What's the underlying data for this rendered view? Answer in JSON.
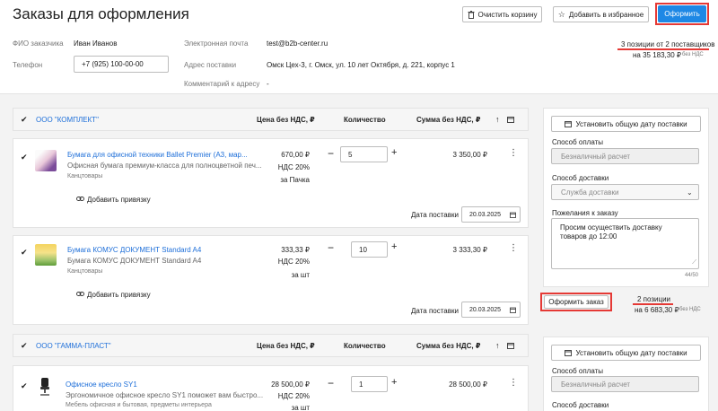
{
  "page": {
    "title": "Заказы для оформления",
    "buttons": {
      "clear_cart": "Очистить корзину",
      "add_favorites": "Добавить в избранное",
      "checkout": "Оформить"
    }
  },
  "customer": {
    "name_label": "ФИО заказчика",
    "name_value": "Иван Иванов",
    "phone_label": "Телефон",
    "phone_value": "+7 (925) 100-00-00",
    "email_label": "Электронная почта",
    "email_value": "test@b2b-center.ru",
    "address_label": "Адрес поставки",
    "address_value": "Омск Цех-3, г. Омск, ул. 10 лет Октября, д. 221, корпус 1",
    "comment_label": "Комментарий к адресу",
    "comment_value": "-"
  },
  "summary": {
    "positions": "3 позиции от 2 поставщиков",
    "total": "на 35 183,30 ₽",
    "vat": "без НДС"
  },
  "columns": {
    "price": "Цена без НДС, ₽",
    "qty": "Количество",
    "sum": "Сумма без НДС, ₽"
  },
  "suppliers": [
    {
      "name": "ООО \"КОМПЛЕКТ\"",
      "items": [
        {
          "title": "Бумага для офисной техники Ballet Premier (А3, мар...",
          "desc": "Офисная бумага премиум-класса для полноцветной печ...",
          "category": "Канцтовары",
          "price": "670,00 ₽",
          "vat": "НДС 20%",
          "unit": "за Пачка",
          "qty": "5",
          "sum": "3 350,00 ₽",
          "bind": "Добавить привязку",
          "date_label": "Дата поставки",
          "date": "20.03.2025"
        },
        {
          "title": "Бумага КОМУС ДОКУМЕНТ Standard A4",
          "desc": "Бумага КОМУС ДОКУМЕНТ Standard A4",
          "category": "Канцтовары",
          "price": "333,33 ₽",
          "vat": "НДС 20%",
          "unit": "за шт",
          "qty": "10",
          "sum": "3 333,30 ₽",
          "bind": "Добавить привязку",
          "date_label": "Дата поставки",
          "date": "20.03.2025"
        }
      ]
    },
    {
      "name": "ООО \"ГАММА-ПЛАСТ\"",
      "items": [
        {
          "title": "Офисное кресло SY1",
          "desc": "Эргономичное офисное кресло SY1 поможет вам быстро...",
          "category": "Мебель офисная и бытовая, предметы интерьера",
          "price": "28 500,00 ₽",
          "vat": "НДС 20%",
          "unit": "за шт",
          "qty": "1",
          "sum": "28 500,00 ₽"
        }
      ]
    }
  ],
  "side": {
    "set_date": "Установить общую дату поставки",
    "payment_label": "Способ оплаты",
    "payment_value": "Безналичный расчет",
    "delivery_label": "Способ доставки",
    "delivery_value": "Служба доставки",
    "wishes_label": "Пожелания к заказу",
    "wishes_value": "Просим осуществить доставку товаров до 12:00",
    "counter": "44/50",
    "order_button": "Оформить заказ",
    "order_positions": "2 позиции",
    "order_total": "на 6 683,30 ₽",
    "order_vat": "без НДС"
  },
  "side2": {
    "set_date": "Установить общую дату поставки",
    "payment_label": "Способ оплаты",
    "payment_value": "Безналичный расчет",
    "delivery_label": "Способ доставки"
  }
}
